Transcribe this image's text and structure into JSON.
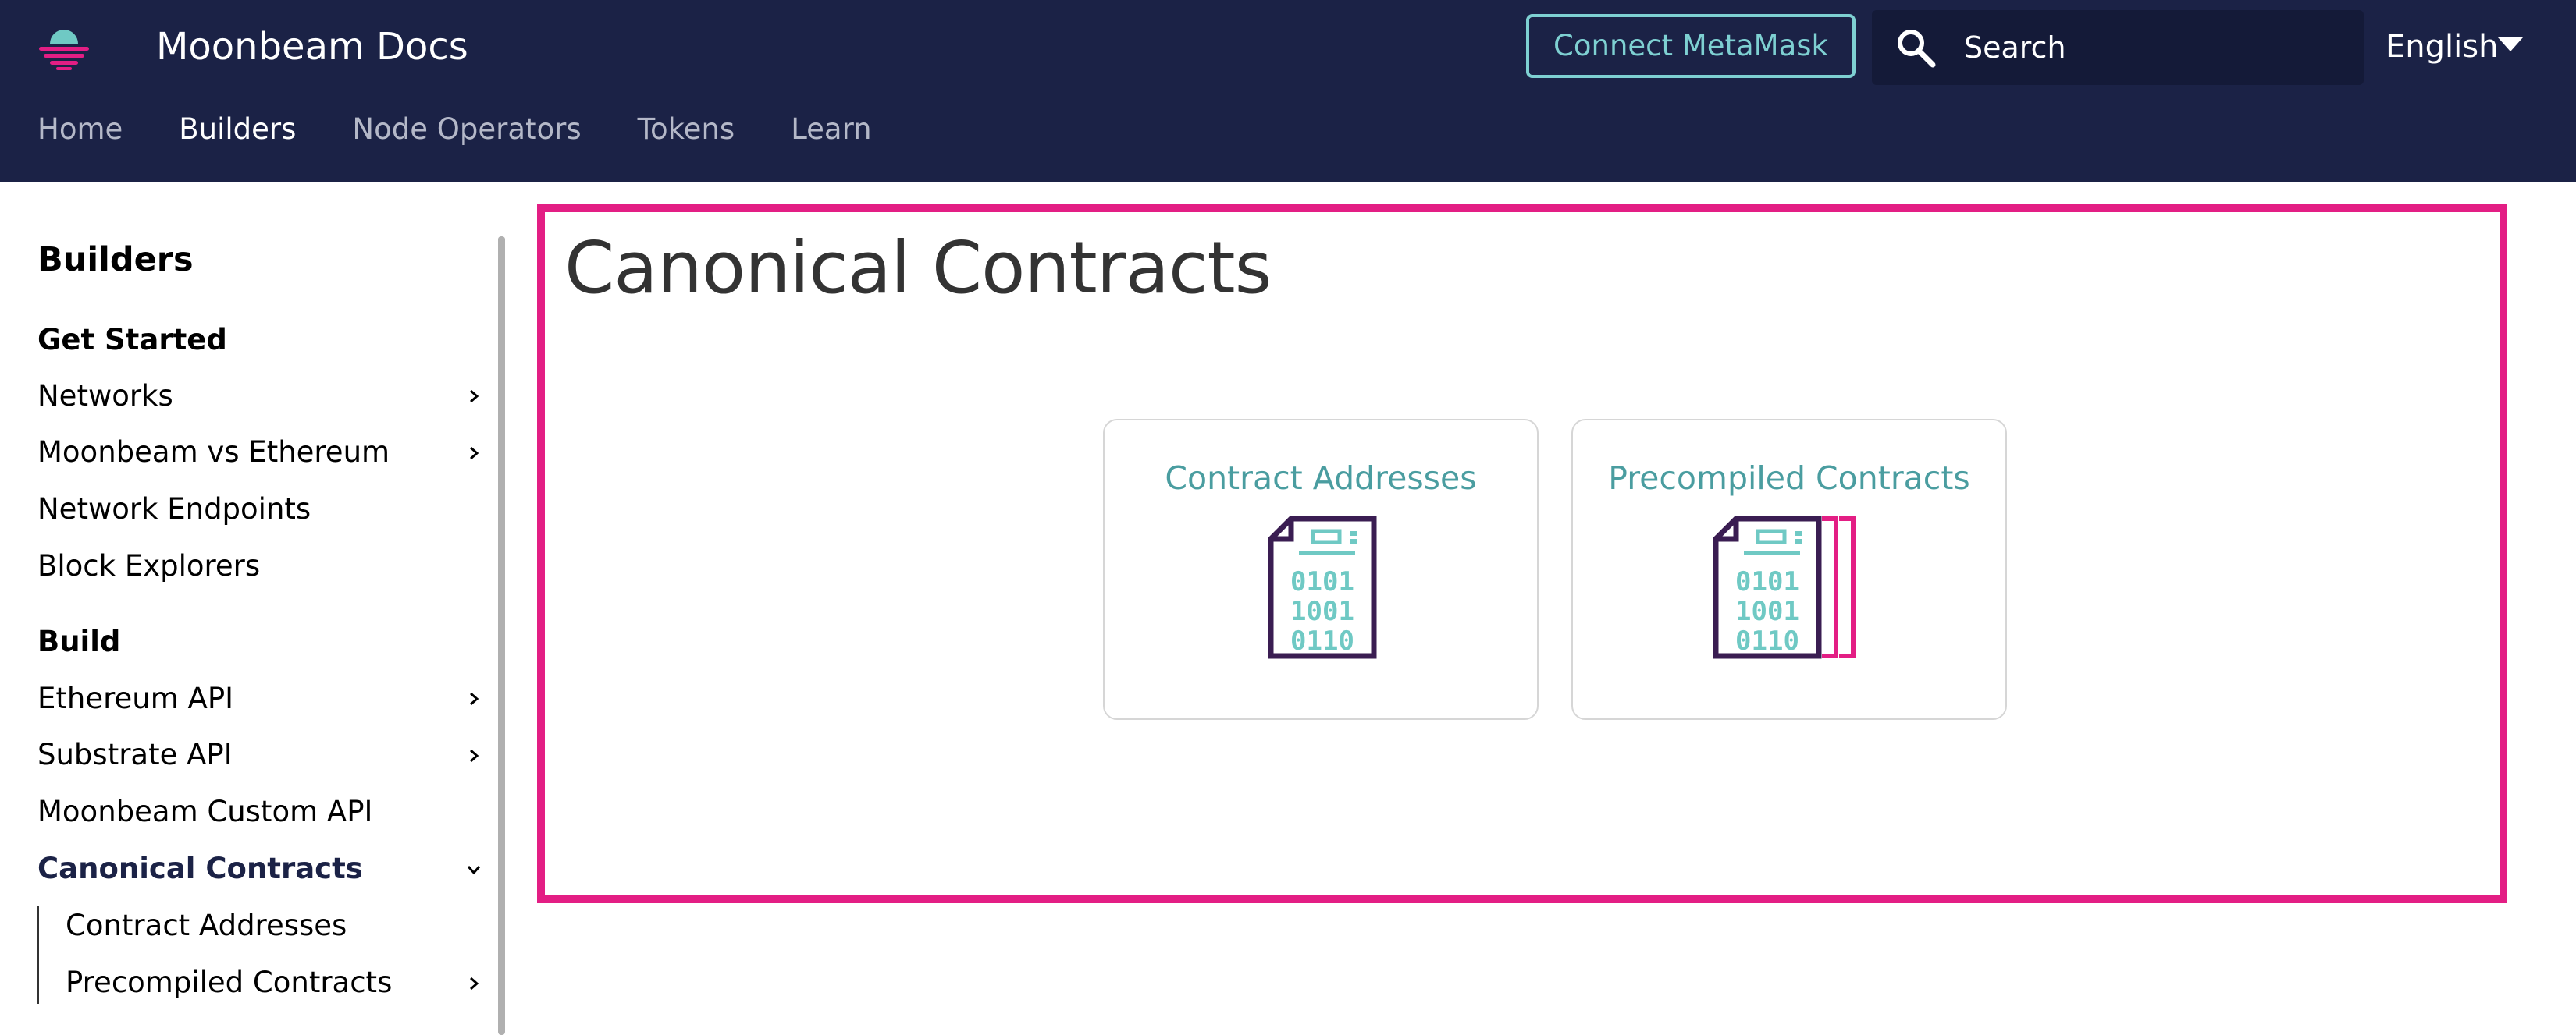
{
  "header": {
    "site_title": "Moonbeam Docs",
    "connect_label": "Connect MetaMask",
    "search_placeholder": "Search",
    "language": "English",
    "nav": [
      "Home",
      "Builders",
      "Node Operators",
      "Tokens",
      "Learn"
    ],
    "active_nav": "Builders"
  },
  "sidebar": {
    "heading": "Builders",
    "get_started": {
      "title": "Get Started",
      "items": [
        "Networks",
        "Moonbeam vs Ethereum",
        "Network Endpoints",
        "Block Explorers"
      ]
    },
    "build": {
      "title": "Build",
      "items": [
        "Ethereum API",
        "Substrate API",
        "Moonbeam Custom API",
        "Canonical Contracts"
      ],
      "sub_items": [
        "Contract Addresses",
        "Precompiled Contracts"
      ]
    }
  },
  "main": {
    "title": "Canonical Contracts",
    "cards": [
      {
        "title": "Contract Addresses",
        "icon": "binary-document-icon"
      },
      {
        "title": "Precompiled Contracts",
        "icon": "binary-documents-stack-icon"
      }
    ]
  },
  "colors": {
    "header_bg": "#1b2246",
    "accent_teal": "#7ed0d2",
    "highlight_pink": "#e31e84",
    "icon_purple": "#3a1d52"
  }
}
